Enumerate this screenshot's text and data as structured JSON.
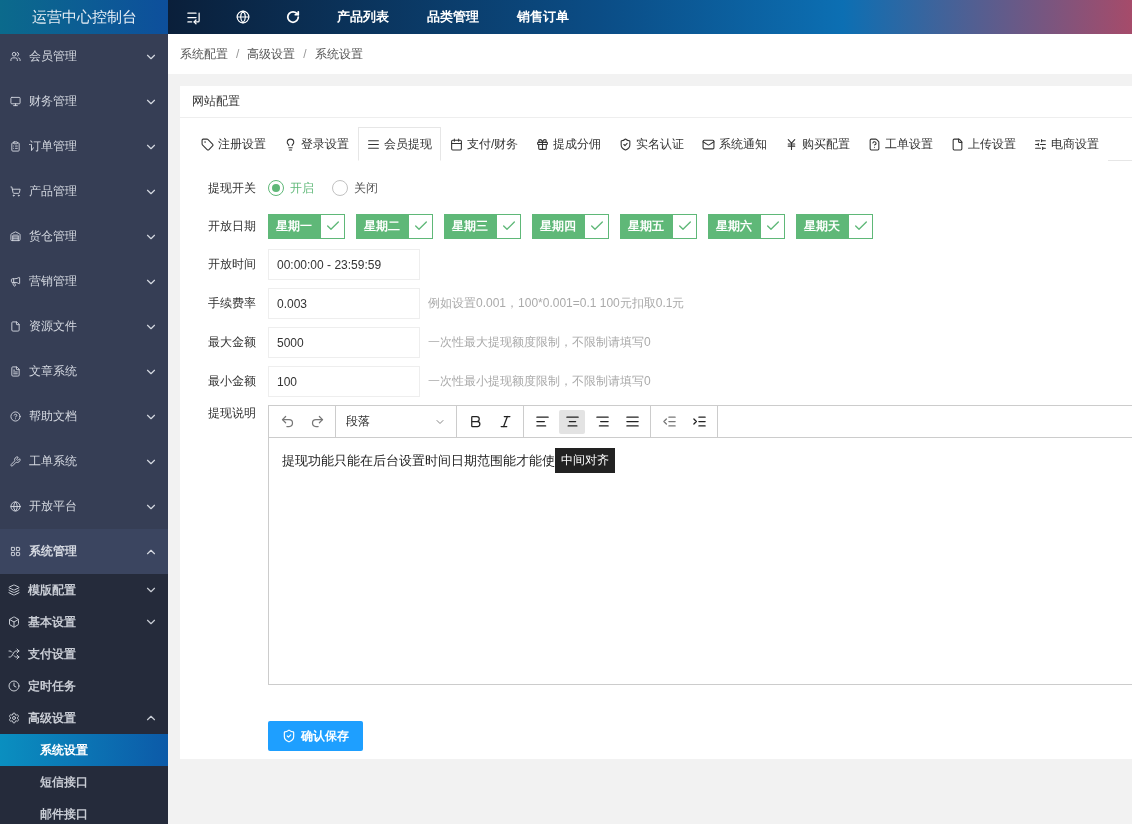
{
  "header": {
    "logo": "运营中心控制台",
    "nav": [
      "产品列表",
      "品类管理",
      "销售订单"
    ]
  },
  "sidebar": {
    "items": [
      {
        "label": "会员管理",
        "expanded": false
      },
      {
        "label": "财务管理",
        "expanded": false
      },
      {
        "label": "订单管理",
        "expanded": false
      },
      {
        "label": "产品管理",
        "expanded": false
      },
      {
        "label": "货仓管理",
        "expanded": false
      },
      {
        "label": "营销管理",
        "expanded": false
      },
      {
        "label": "资源文件",
        "expanded": false
      },
      {
        "label": "文章系统",
        "expanded": false
      },
      {
        "label": "帮助文档",
        "expanded": false
      },
      {
        "label": "工单系统",
        "expanded": false
      },
      {
        "label": "开放平台",
        "expanded": false
      },
      {
        "label": "系统管理",
        "expanded": true,
        "children": [
          {
            "label": "模版配置",
            "kind": "group",
            "expanded": false,
            "selected": false
          },
          {
            "label": "基本设置",
            "kind": "group",
            "expanded": false,
            "selected": false
          },
          {
            "label": "支付设置",
            "kind": "link",
            "selected": false
          },
          {
            "label": "定时任务",
            "kind": "link",
            "selected": false
          },
          {
            "label": "高级设置",
            "kind": "group",
            "expanded": true,
            "selected": false,
            "children": [
              {
                "label": "系统设置",
                "selected": true
              },
              {
                "label": "短信接口",
                "selected": false
              },
              {
                "label": "邮件接口",
                "selected": false
              }
            ]
          }
        ]
      }
    ]
  },
  "breadcrumb": {
    "separator": "/",
    "items": [
      "系统配置",
      "高级设置",
      "系统设置"
    ]
  },
  "card": {
    "title": "网站配置",
    "tabs": [
      {
        "label": "注册设置",
        "selected": false
      },
      {
        "label": "登录设置",
        "selected": false
      },
      {
        "label": "会员提现",
        "selected": true
      },
      {
        "label": "支付/财务",
        "selected": false
      },
      {
        "label": "提成分佣",
        "selected": false
      },
      {
        "label": "实名认证",
        "selected": false
      },
      {
        "label": "系统通知",
        "selected": false
      },
      {
        "label": "购买配置",
        "selected": false
      },
      {
        "label": "工单设置",
        "selected": false
      },
      {
        "label": "上传设置",
        "selected": false
      },
      {
        "label": "电商设置",
        "selected": false
      }
    ],
    "form": [
      {
        "kind": "radio",
        "label": "提现开关",
        "options": [
          {
            "label": "开启",
            "selected": true
          },
          {
            "label": "关闭",
            "selected": false
          }
        ]
      },
      {
        "kind": "days",
        "label": "开放日期",
        "days": [
          {
            "label": "星期一",
            "checked": true
          },
          {
            "label": "星期二",
            "checked": true
          },
          {
            "label": "星期三",
            "checked": true
          },
          {
            "label": "星期四",
            "checked": true
          },
          {
            "label": "星期五",
            "checked": true
          },
          {
            "label": "星期六",
            "checked": true
          },
          {
            "label": "星期天",
            "checked": true
          }
        ]
      },
      {
        "kind": "text",
        "label": "开放时间",
        "value": "00:00:00 - 23:59:59"
      },
      {
        "kind": "text",
        "label": "手续费率",
        "value": "0.003",
        "hint": "例如设置0.001，100*0.001=0.1 100元扣取0.1元"
      },
      {
        "kind": "text",
        "label": "最大金额",
        "value": "5000",
        "hint": "一次性最大提现额度限制，不限制请填写0"
      },
      {
        "kind": "text",
        "label": "最小金额",
        "value": "100",
        "hint": "一次性最小提现额度限制，不限制请填写0"
      },
      {
        "kind": "editor",
        "label": "提现说明",
        "block_format": "段落",
        "toolbar": [
          {
            "kind": "undo",
            "selected": false
          },
          {
            "kind": "redo",
            "selected": false
          },
          {
            "kind": "format"
          },
          {
            "kind": "bold",
            "selected": false
          },
          {
            "kind": "italic",
            "selected": false
          },
          {
            "kind": "align-left",
            "selected": false
          },
          {
            "kind": "align-center",
            "selected": true
          },
          {
            "kind": "align-right",
            "selected": false
          },
          {
            "kind": "justify",
            "selected": false
          },
          {
            "kind": "outdent",
            "selected": false
          },
          {
            "kind": "indent",
            "selected": false
          }
        ],
        "content": "提现功能只能在后台设置时间日期范围能才能使",
        "tooltip": "中间对齐"
      }
    ],
    "save_button": "确认保存"
  }
}
